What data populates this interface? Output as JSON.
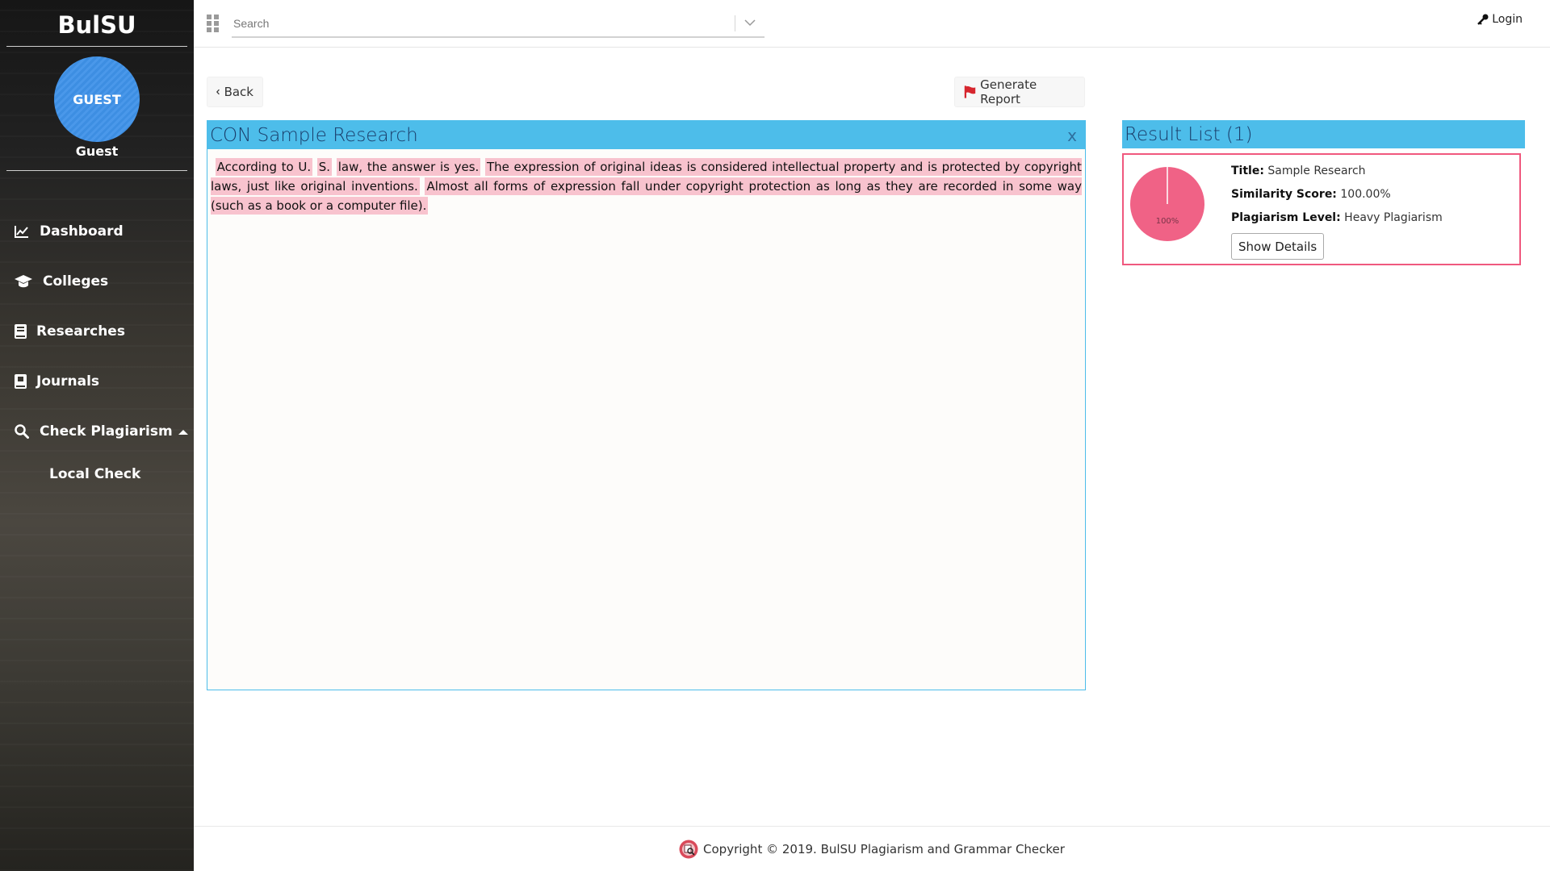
{
  "sidebar": {
    "brand": "BulSU",
    "avatar_text": "GUEST",
    "user_name": "Guest",
    "items": [
      {
        "label": "Dashboard",
        "icon": "chart-line-icon"
      },
      {
        "label": "Colleges",
        "icon": "graduation-cap-icon"
      },
      {
        "label": "Researches",
        "icon": "book-icon"
      },
      {
        "label": "Journals",
        "icon": "journal-icon"
      },
      {
        "label": "Check Plagiarism",
        "icon": "search-icon"
      }
    ],
    "sub_items": [
      {
        "label": "Local Check"
      }
    ]
  },
  "topbar": {
    "search_placeholder": "Search",
    "login_label": "Login"
  },
  "toolbar": {
    "back_label": "Back",
    "report_label": "Generate Report"
  },
  "document": {
    "title": "CON Sample Research",
    "close_label": "x",
    "segments": [
      "According to U.",
      "S.",
      "law, the answer is yes.",
      "The expression of original ideas is considered intellectual property and is protected by copyright laws, just like original inventions.",
      "Almost all forms of expression fall under copyright protection as long as they are recorded in some way (such as a book or a computer file)."
    ]
  },
  "results": {
    "heading": "Result List (1)",
    "items": [
      {
        "title_label": "Title:",
        "title": "Sample Research",
        "score_label": "Similarity Score:",
        "score": "100.00%",
        "level_label": "Plagiarism Level:",
        "level": "Heavy Plagiarism",
        "pie_label": "100%",
        "similarity": 1.0,
        "details_label": "Show Details"
      }
    ]
  },
  "footer": {
    "text": "Copyright © 2019. BulSU Plagiarism and Grammar Checker"
  },
  "colors": {
    "accent": "#4dbdea",
    "highlight": "#f8c3ce",
    "danger": "#f0587e"
  }
}
